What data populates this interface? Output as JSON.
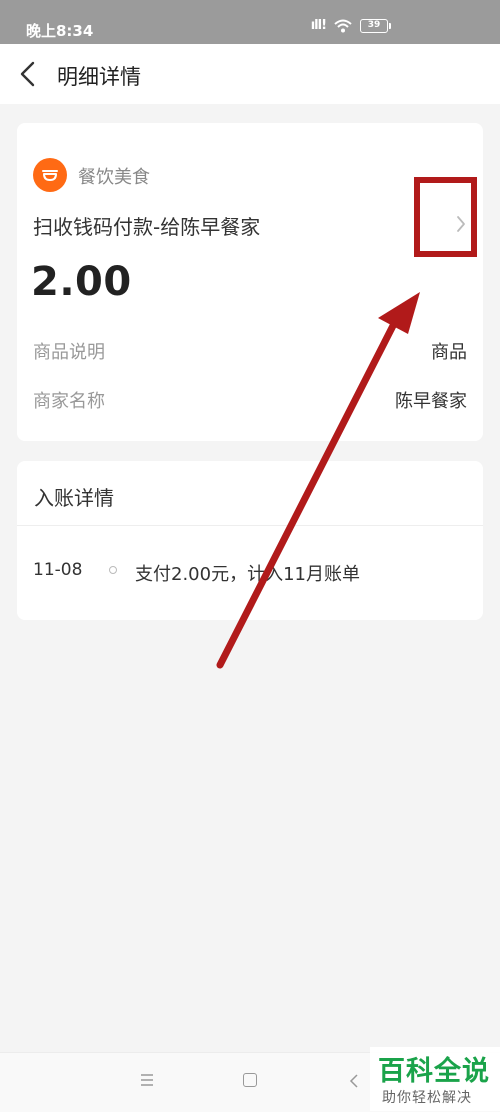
{
  "status_bar": {
    "time": "晚上8:34",
    "signal": "ıll!",
    "battery": "39"
  },
  "nav": {
    "title": "明细详情"
  },
  "transaction": {
    "category": "餐饮美食",
    "title": "扫收钱码付款-给陈早餐家",
    "amount": "2.00",
    "rows": [
      {
        "label": "商品说明",
        "value": "商品"
      },
      {
        "label": "商家名称",
        "value": "陈早餐家"
      }
    ]
  },
  "entry": {
    "title": "入账详情",
    "date": "11-08",
    "text": "支付2.00元，计入11月账单"
  },
  "watermark": {
    "main": "百科全说",
    "sub": "助你轻松解决"
  },
  "colors": {
    "category_icon": "#ff6a14",
    "annotation": "#b11a1a",
    "watermark": "#1aa34a"
  }
}
